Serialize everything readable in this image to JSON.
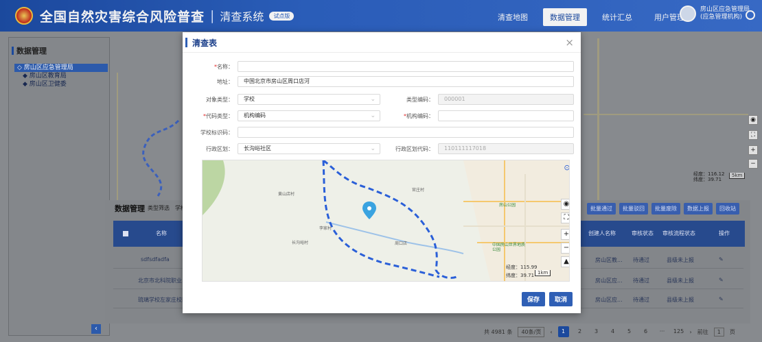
{
  "header": {
    "title": "全国自然灾害综合风险普查",
    "separator": "|",
    "subtitle": "清查系统",
    "badge": "试点版",
    "nav": [
      "清查地图",
      "数据管理",
      "统计汇总",
      "用户管理"
    ],
    "nav_active_index": 1,
    "user_name": "房山区应急管理局(应急管理机构)"
  },
  "sidebar": {
    "title": "数据管理",
    "tree": [
      {
        "label": "◇ 房山区应急管理局",
        "selected": true,
        "level": 0
      },
      {
        "label": "◆ 房山区教育局",
        "selected": false,
        "level": 1
      },
      {
        "label": "◆ 房山区卫健委",
        "selected": false,
        "level": 1
      }
    ],
    "collapse_icon": "‹"
  },
  "management": {
    "title": "数据管理",
    "filter_label": "类型筛选",
    "filter_value": "学校",
    "headers": [
      "名称",
      "创建人名称",
      "审核状态",
      "审核流程状态",
      "操作"
    ],
    "buttons": [
      "批量通过",
      "批量驳回",
      "批量废除",
      "数据上报",
      "回收站"
    ],
    "rows": [
      {
        "name": "sdfsdfadfa",
        "creator": "房山区教...",
        "audit": "待通过",
        "flow": "县级未上报"
      },
      {
        "name": "北京市北科院职业...",
        "creator": "房山区应...",
        "audit": "待通过",
        "flow": "县级未上报"
      },
      {
        "name": "琉璃学校左家庄校区",
        "creator": "房山区应...",
        "audit": "待通过",
        "flow": "县级未上报"
      }
    ],
    "pagination": {
      "total": "共 4981 条",
      "page_size": "40条/页",
      "pages": [
        "1",
        "2",
        "3",
        "4",
        "5",
        "6",
        "···",
        "125"
      ],
      "active": "1",
      "goto_label": "前往",
      "goto_value": "1",
      "page_unit": "页"
    }
  },
  "dialog": {
    "title": "清查表",
    "close": "×",
    "fields": {
      "name": {
        "label": "名称：",
        "required": true,
        "value": ""
      },
      "address": {
        "label": "地址：",
        "value": "中国北京市房山区周口店河"
      },
      "object_type": {
        "label": "对象类型：",
        "value": "学校"
      },
      "type_code": {
        "label": "类型编码：",
        "value": "000001"
      },
      "code_type": {
        "label": "代码类型：",
        "required": true,
        "value": "机构编码"
      },
      "org_code": {
        "label": "机构编码：",
        "required": true,
        "value": ""
      },
      "school_id": {
        "label": "学校标识码：",
        "value": ""
      },
      "division": {
        "label": "行政区划：",
        "value": "长沟峪社区"
      },
      "division_code": {
        "label": "行政区划代码：",
        "value": "110111117018"
      }
    },
    "map": {
      "labels": [
        "官庄村",
        "房山公园",
        "黄山店村",
        "中国房山世界地质公园",
        "长沟峪村",
        "周口店",
        "李家村"
      ],
      "longitude": "经度：115.99",
      "latitude": "纬度：39.71",
      "scale": "1km",
      "zoom_in": "+",
      "zoom_out": "−"
    },
    "save": "保存",
    "cancel": "取消"
  },
  "bg_map": {
    "longitude": "经度：116.12",
    "latitude": "纬度：39.71",
    "scale": "5km"
  }
}
